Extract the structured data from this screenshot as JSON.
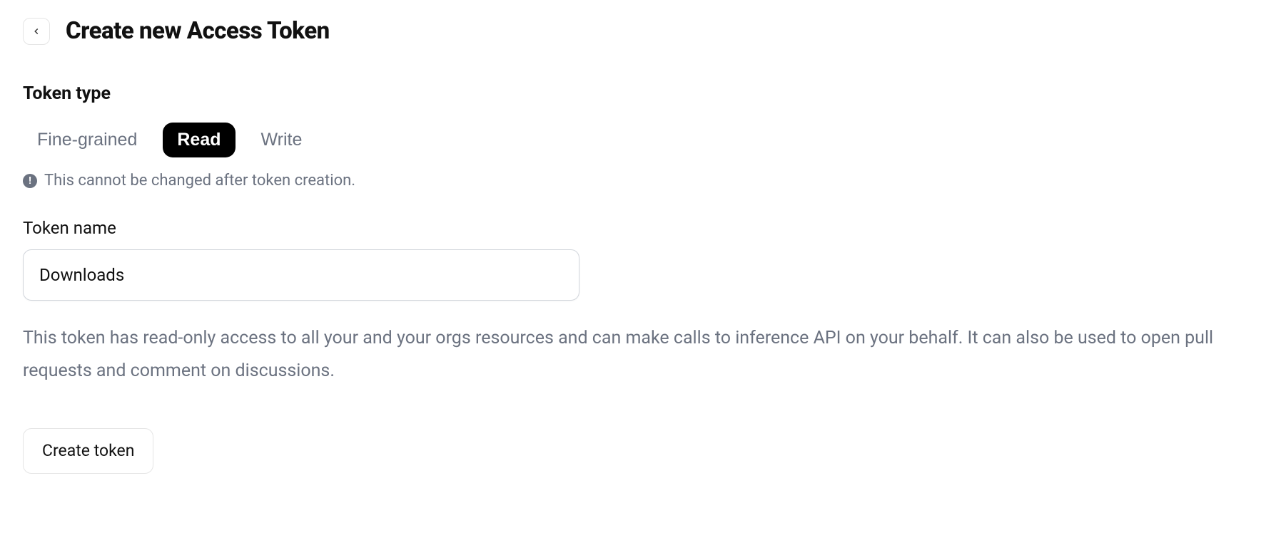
{
  "header": {
    "title": "Create new Access Token"
  },
  "token_type": {
    "label": "Token type",
    "options": {
      "fine_grained": "Fine-grained",
      "read": "Read",
      "write": "Write"
    },
    "warning": "This cannot be changed after token creation."
  },
  "token_name": {
    "label": "Token name",
    "value": "Downloads"
  },
  "description": "This token has read-only access to all your and your orgs resources and can make calls to inference API on your behalf. It can also be used to open pull requests and comment on discussions.",
  "actions": {
    "create": "Create token"
  }
}
